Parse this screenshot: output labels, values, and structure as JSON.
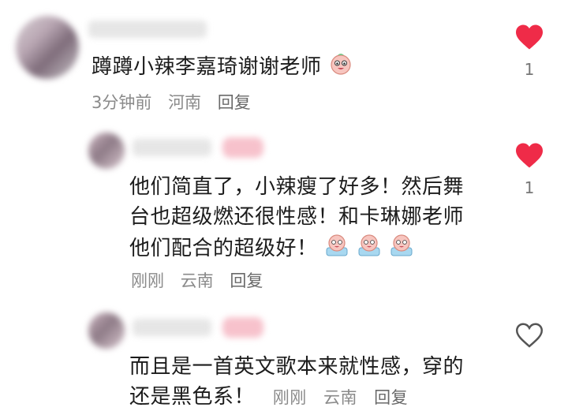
{
  "comments": [
    {
      "text": "蹲蹲小辣李嘉琦谢谢老师",
      "time": "3分钟前",
      "location": "河南",
      "reply_label": "回复",
      "likes": "1",
      "liked": true,
      "emoji_icons": [
        "smile-face-icon"
      ]
    },
    {
      "text_lines": [
        "他们简直了，小辣瘦了好多！然后舞",
        "台也超级燃还很性感！和卡琳娜老师",
        "他们配合的超级好！"
      ],
      "time": "刚刚",
      "location": "云南",
      "reply_label": "回复",
      "likes": "1",
      "liked": true,
      "emoji_icons": [
        "cheer-face-icon",
        "cheer-face-icon",
        "cheer-face-icon"
      ]
    },
    {
      "text_lines": [
        "而且是一首英文歌本来就性感，穿的",
        "还是黑色系！"
      ],
      "time": "刚刚",
      "location": "云南",
      "reply_label": "回复",
      "liked": false
    }
  ],
  "colors": {
    "liked_heart": "#ef2b48",
    "unliked_heart": "#555555"
  }
}
